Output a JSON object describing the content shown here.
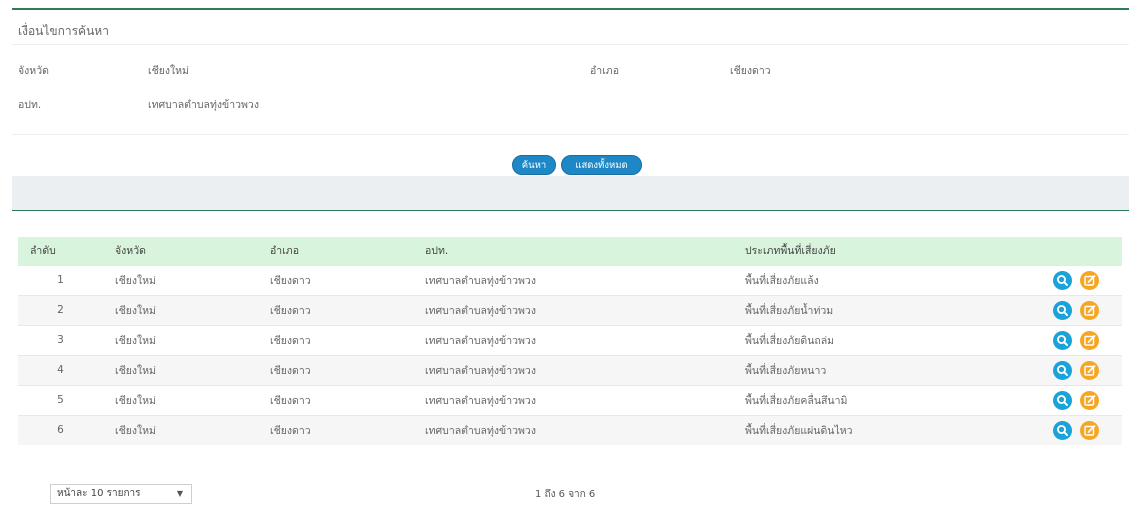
{
  "search_panel": {
    "title": "เงื่อนไขการค้นหา",
    "province_label": "จังหวัด",
    "province_value": "เชียงใหม่",
    "district_label": "อำเภอ",
    "district_value": "เชียงดาว",
    "lao_label": "อปท.",
    "lao_value": "เทศบาลตำบลทุ่งข้าวพวง",
    "search_button": "ค้นหา",
    "show_all_button": "แสดงทั้งหมด"
  },
  "table": {
    "headers": [
      "ลำดับ",
      "จังหวัด",
      "อำเภอ",
      "อปท.",
      "ประเภทพื้นที่เสี่ยงภัย"
    ],
    "rows": [
      {
        "no": "1",
        "province": "เชียงใหม่",
        "district": "เชียงดาว",
        "lao": "เทศบาลตำบลทุ่งข้าวพวง",
        "type": "พื้นที่เสี่ยงภัยแล้ง"
      },
      {
        "no": "2",
        "province": "เชียงใหม่",
        "district": "เชียงดาว",
        "lao": "เทศบาลตำบลทุ่งข้าวพวง",
        "type": "พื้นที่เสี่ยงภัยน้ำท่วม"
      },
      {
        "no": "3",
        "province": "เชียงใหม่",
        "district": "เชียงดาว",
        "lao": "เทศบาลตำบลทุ่งข้าวพวง",
        "type": "พื้นที่เสี่ยงภัยดินถล่ม"
      },
      {
        "no": "4",
        "province": "เชียงใหม่",
        "district": "เชียงดาว",
        "lao": "เทศบาลตำบลทุ่งข้าวพวง",
        "type": "พื้นที่เสี่ยงภัยหนาว"
      },
      {
        "no": "5",
        "province": "เชียงใหม่",
        "district": "เชียงดาว",
        "lao": "เทศบาลตำบลทุ่งข้าวพวง",
        "type": "พื้นที่เสี่ยงภัยคลื่นสึนามิ"
      },
      {
        "no": "6",
        "province": "เชียงใหม่",
        "district": "เชียงดาว",
        "lao": "เทศบาลตำบลทุ่งข้าวพวง",
        "type": "พื้นที่เสี่ยงภัยแผ่นดินไหว"
      }
    ],
    "action_icons": [
      "search-icon",
      "edit-icon"
    ]
  },
  "pager": {
    "page_size": "หน้าละ 10 รายการ",
    "info": "1 ถึง 6 จาก 6"
  },
  "colors": {
    "accent_green": "#2e7d56",
    "header_bg": "#d9f4dc",
    "button_blue": "#1e88c7",
    "view_icon": "#1aa3d8",
    "edit_icon": "#f5a623"
  }
}
